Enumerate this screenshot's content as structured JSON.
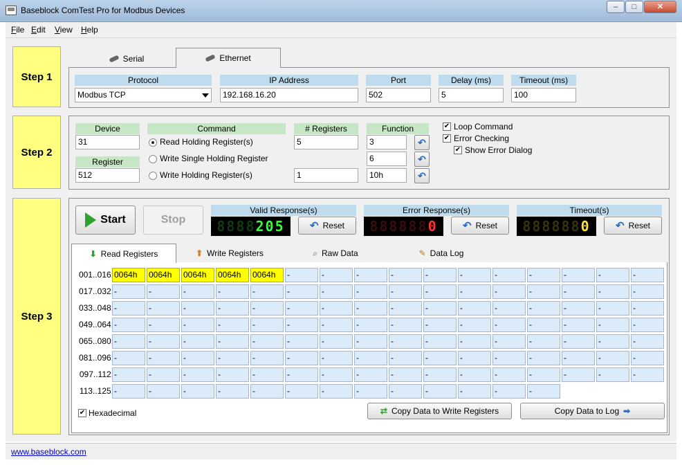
{
  "window": {
    "title": "Baseblock ComTest Pro for Modbus Devices",
    "min": "–",
    "max": "□",
    "close": "✕"
  },
  "menu": [
    {
      "label": "File",
      "accel": "F",
      "rest": "ile"
    },
    {
      "label": "Edit",
      "accel": "E",
      "rest": "dit"
    },
    {
      "label": "View",
      "accel": "V",
      "rest": "iew"
    },
    {
      "label": "Help",
      "accel": "H",
      "rest": "elp"
    }
  ],
  "step1": {
    "label": "Step 1",
    "tabs": [
      {
        "label": "Serial",
        "active": false
      },
      {
        "label": "Ethernet",
        "active": true
      }
    ],
    "protocol": {
      "header": "Protocol",
      "value": "Modbus TCP"
    },
    "ip": {
      "header": "IP Address",
      "value": "192.168.16.20"
    },
    "port": {
      "header": "Port",
      "value": "502"
    },
    "delay": {
      "header": "Delay (ms)",
      "value": "5"
    },
    "timeout": {
      "header": "Timeout (ms)",
      "value": "100"
    }
  },
  "step2": {
    "label": "Step 2",
    "device": {
      "header": "Device",
      "value": "31"
    },
    "register": {
      "header": "Register",
      "value": "512"
    },
    "command": {
      "header": "Command",
      "options": [
        {
          "label": "Read Holding Register(s)",
          "selected": true
        },
        {
          "label": "Write Single Holding Register",
          "selected": false
        },
        {
          "label": "Write Holding Register(s)",
          "selected": false
        }
      ]
    },
    "num_registers": {
      "header": "# Registers",
      "values": [
        "5",
        "",
        "1"
      ]
    },
    "function": {
      "header": "Function",
      "values": [
        "3",
        "6",
        "10h"
      ]
    },
    "checks": [
      {
        "label": "Loop Command",
        "checked": true
      },
      {
        "label": "Error Checking",
        "checked": true
      },
      {
        "label": "Show Error Dialog",
        "checked": true
      }
    ]
  },
  "step3": {
    "label": "Step 3",
    "start": "Start",
    "stop": "Stop",
    "counters": [
      {
        "header": "Valid Response(s)",
        "dim": "8888",
        "lit": "205",
        "reset": "Reset"
      },
      {
        "header": "Error Response(s)",
        "dim": "888888",
        "lit": "0",
        "reset": "Reset"
      },
      {
        "header": "Timeout(s)",
        "dim": "888888",
        "lit": "0",
        "reset": "Reset"
      }
    ],
    "tabs": [
      {
        "label": "Read Registers",
        "active": true
      },
      {
        "label": "Write Registers",
        "active": false
      },
      {
        "label": "Raw Data",
        "active": false
      },
      {
        "label": "Data Log",
        "active": false
      }
    ],
    "grid": {
      "rows": [
        {
          "label": "001..016:",
          "cells": [
            "0064h",
            "0064h",
            "0064h",
            "0064h",
            "0064h",
            "-",
            "-",
            "-",
            "-",
            "-",
            "-",
            "-",
            "-",
            "-",
            "-",
            "-"
          ]
        },
        {
          "label": "017..032:",
          "cells": [
            "-",
            "-",
            "-",
            "-",
            "-",
            "-",
            "-",
            "-",
            "-",
            "-",
            "-",
            "-",
            "-",
            "-",
            "-",
            "-"
          ]
        },
        {
          "label": "033..048:",
          "cells": [
            "-",
            "-",
            "-",
            "-",
            "-",
            "-",
            "-",
            "-",
            "-",
            "-",
            "-",
            "-",
            "-",
            "-",
            "-",
            "-"
          ]
        },
        {
          "label": "049..064:",
          "cells": [
            "-",
            "-",
            "-",
            "-",
            "-",
            "-",
            "-",
            "-",
            "-",
            "-",
            "-",
            "-",
            "-",
            "-",
            "-",
            "-"
          ]
        },
        {
          "label": "065..080:",
          "cells": [
            "-",
            "-",
            "-",
            "-",
            "-",
            "-",
            "-",
            "-",
            "-",
            "-",
            "-",
            "-",
            "-",
            "-",
            "-",
            "-"
          ]
        },
        {
          "label": "081..096:",
          "cells": [
            "-",
            "-",
            "-",
            "-",
            "-",
            "-",
            "-",
            "-",
            "-",
            "-",
            "-",
            "-",
            "-",
            "-",
            "-",
            "-"
          ]
        },
        {
          "label": "097..112:",
          "cells": [
            "-",
            "-",
            "-",
            "-",
            "-",
            "-",
            "-",
            "-",
            "-",
            "-",
            "-",
            "-",
            "-",
            "-",
            "-",
            "-"
          ]
        },
        {
          "label": "113..125:",
          "cells": [
            "-",
            "-",
            "-",
            "-",
            "-",
            "-",
            "-",
            "-",
            "-",
            "-",
            "-",
            "-",
            "-"
          ]
        }
      ]
    },
    "hexadecimal": {
      "label": "Hexadecimal",
      "checked": true
    },
    "copy_write": "Copy Data to Write Registers",
    "copy_log": "Copy Data to Log"
  },
  "status": {
    "link": "www.baseblock.com"
  },
  "colors": {
    "step_bg": "#ffff80",
    "header_blue": "#bfdcef",
    "header_green": "#c6e6c6",
    "cell_bg": "#dcebfa",
    "cell_active": "#ffff00"
  }
}
